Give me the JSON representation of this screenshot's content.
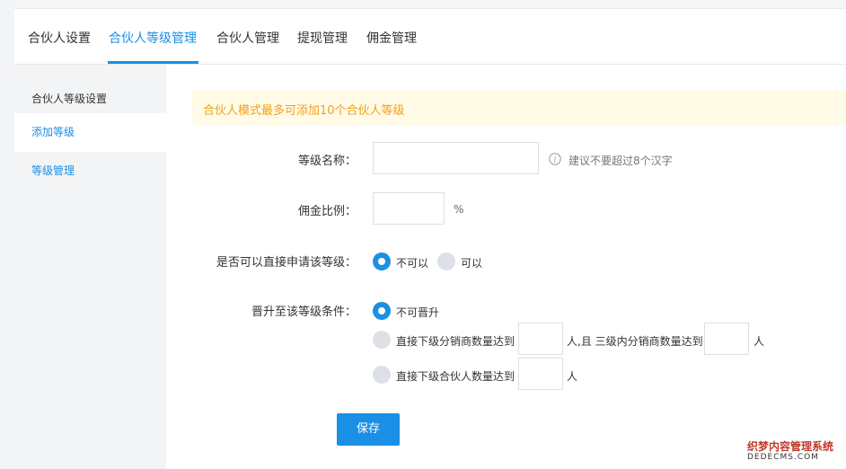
{
  "tabs": [
    {
      "label": "合伙人设置"
    },
    {
      "label": "合伙人等级管理"
    },
    {
      "label": "合伙人管理"
    },
    {
      "label": "提现管理"
    },
    {
      "label": "佣金管理"
    }
  ],
  "sidebar": {
    "title": "合伙人等级设置",
    "items": [
      {
        "label": "添加等级"
      },
      {
        "label": "等级管理"
      }
    ]
  },
  "notice": "合伙人模式最多可添加10个合伙人等级",
  "form": {
    "level_name_label": "等级名称：",
    "level_name_value": "",
    "level_name_hint": "建议不要超过8个汉字",
    "commission_label": "佣金比例：",
    "commission_value": "",
    "commission_unit": "%",
    "apply_label": "是否可以直接申请该等级：",
    "apply_options": [
      "不可以",
      "可以"
    ],
    "apply_selected": "不可以",
    "upgrade_label": "晋升至该等级条件：",
    "upgrade_option1": "不可晋升",
    "upgrade_option2_prefix": "直接下级分销商数量达到",
    "upgrade_option2_middle": "人,且 三级内分销商数量达到",
    "upgrade_option2_suffix": "人",
    "upgrade_option3_prefix": "直接下级合伙人数量达到",
    "upgrade_option3_suffix": "人",
    "upgrade_selected": "不可晋升"
  },
  "save_label": "保存",
  "watermark": {
    "line1": "织梦内容管理系统",
    "line2": "DEDECMS.COM"
  },
  "colors": {
    "accent": "#1a8fe6",
    "notice_bg": "#fffbe6",
    "notice_text": "#f0a020",
    "sidebar_bg": "#f2f4f6"
  }
}
